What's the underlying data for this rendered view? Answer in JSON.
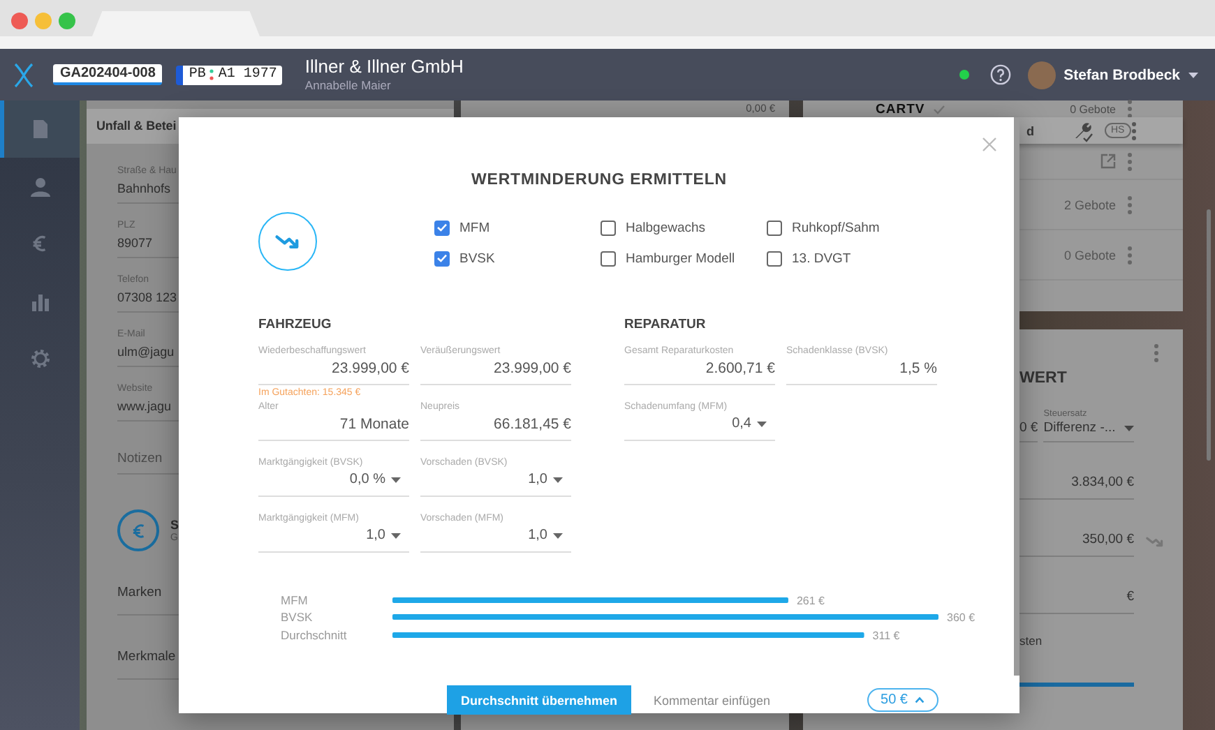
{
  "header": {
    "case_number": "GA202404-008",
    "plate_region": "PB",
    "plate_number": "A1 1977",
    "company": "Illner & Illner GmbH",
    "contact": "Annabelle Maier",
    "user": "Stefan Brodbeck"
  },
  "sidebar": {
    "items": [
      {
        "selected": true
      },
      {
        "selected": false
      },
      {
        "selected": false
      },
      {
        "selected": false
      },
      {
        "selected": false
      }
    ]
  },
  "claim_card": {
    "title": "Unfall & Betei",
    "fields": [
      {
        "label": "Straße & Hau",
        "value": "Bahnhofs"
      },
      {
        "label": "PLZ",
        "value": "89077"
      },
      {
        "label": "Telefon",
        "value": "07308 123"
      },
      {
        "label": "E-Mail",
        "value": "ulm@jagu"
      },
      {
        "label": "Website",
        "value": "www.jagu"
      }
    ],
    "notes_placeholder": "Notizen",
    "summary_title": "S",
    "summary_subtitle": "G",
    "sections": [
      "Marken",
      "Merkmale"
    ]
  },
  "offers_card": {
    "amount": "0,00 €",
    "brand": "CARTV",
    "top_bids": "0 Gebote",
    "toolbar_fragment": "d",
    "badge": "HS",
    "rows": [
      {
        "kind": "link"
      },
      {
        "kind": "bids",
        "bids": "2 Gebote"
      },
      {
        "kind": "bids",
        "bids": "0 Gebote"
      }
    ]
  },
  "value_card": {
    "title": "WERT",
    "price_fragment": "0 €",
    "tax_label": "Steuersatz",
    "tax_value": "Differenz -...",
    "amounts": [
      {
        "kind": "plain",
        "value": "3.834,00 €"
      },
      {
        "kind": "trend",
        "value": "350,00 €"
      },
      {
        "kind": "plain",
        "value": "€"
      }
    ],
    "footer_fragment": "sten",
    "progress": {
      "level": 1
    }
  },
  "modal": {
    "title": "WERTMINDERUNG ERMITTELN",
    "methods": [
      {
        "label": "MFM",
        "checked": true
      },
      {
        "label": "Halbgewachs",
        "checked": false
      },
      {
        "label": "Ruhkopf/Sahm",
        "checked": false
      },
      {
        "label": "BVSK",
        "checked": true
      },
      {
        "label": "Hamburger Modell",
        "checked": false
      },
      {
        "label": "13. DVGT",
        "checked": false
      }
    ],
    "sections": [
      {
        "title": "FAHRZEUG",
        "fields": [
          {
            "label": "Wiederbeschaffungswert",
            "value": "23.999,00 €",
            "kind": "input",
            "note": "Im Gutachten: 15.345 €"
          },
          {
            "label": "Veräußerungswert",
            "value": "23.999,00 €",
            "kind": "input"
          },
          {
            "label": "Alter",
            "value": "71 Monate",
            "kind": "input"
          },
          {
            "label": "Neupreis",
            "value": "66.181,45 €",
            "kind": "input"
          },
          {
            "label": "Marktgängigkeit (BVSK)",
            "value": "0,0 %",
            "kind": "select"
          },
          {
            "label": "Vorschaden (BVSK)",
            "value": "1,0",
            "kind": "select"
          },
          {
            "label": "Marktgängigkeit (MFM)",
            "value": "1,0",
            "kind": "select"
          },
          {
            "label": "Vorschaden (MFM)",
            "value": "1,0",
            "kind": "select"
          }
        ]
      },
      {
        "title": "REPARATUR",
        "fields": [
          {
            "label": "Gesamt Reparaturkosten",
            "value": "2.600,71 €",
            "kind": "input"
          },
          {
            "label": "Schadenklasse (BVSK)",
            "value": "1,5 %",
            "kind": "input"
          },
          {
            "label": "Schadenumfang (MFM)",
            "value": "0,4",
            "kind": "select"
          }
        ]
      }
    ],
    "chart_data": {
      "type": "bar",
      "orientation": "horizontal",
      "categories": [
        "MFM",
        "BVSK",
        "Durchschnitt"
      ],
      "values": [
        261,
        360,
        311
      ],
      "value_labels": [
        "261 €",
        "360 €",
        "311 €"
      ]
    },
    "primary_button": "Durchschnitt übernehmen",
    "secondary_link": "Kommentar einfügen",
    "rounding": "50 €"
  }
}
